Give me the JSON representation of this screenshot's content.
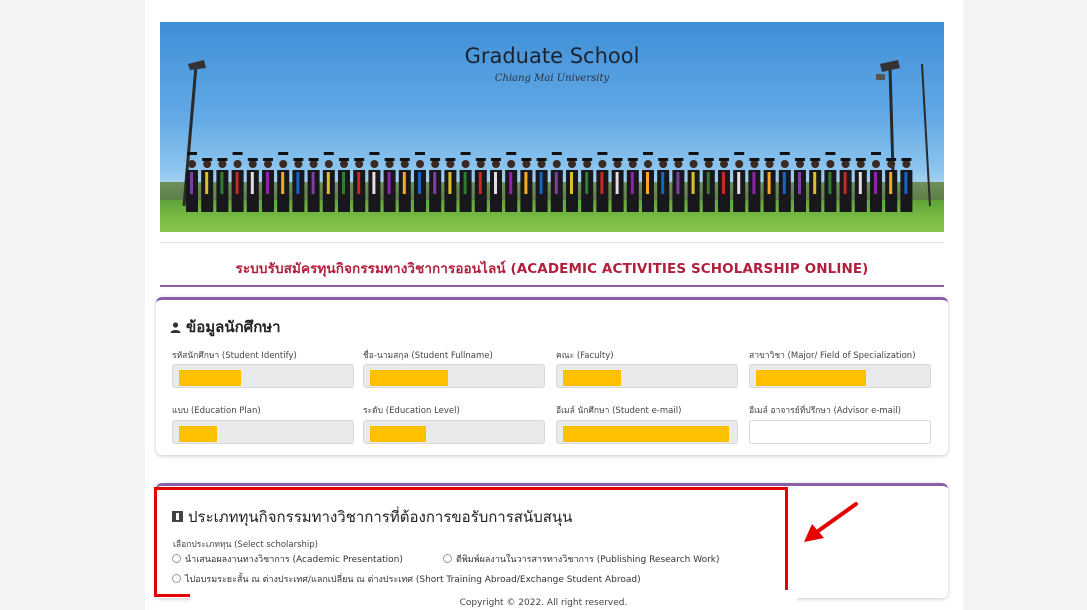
{
  "banner": {
    "title": "Graduate School",
    "subtitle": "Chiang Mai University"
  },
  "system_title": "ระบบรับสมัครทุนกิจกรรมทางวิชาการออนไลน์ (ACADEMIC ACTIVITIES SCHOLARSHIP ONLINE)",
  "student_section": {
    "title": "ข้อมูลนักศึกษา",
    "fields": [
      {
        "label": "รหัสนักศึกษา (Student Identify)",
        "redacted": true
      },
      {
        "label": "ชื่อ-นามสกุล (Student Fullname)",
        "redacted": true
      },
      {
        "label": "คณะ (Faculty)",
        "redacted": true
      },
      {
        "label": "สาขาวิชา (Major/ Field of Specialization)",
        "redacted": true
      },
      {
        "label": "แบบ (Education Plan)",
        "redacted": true
      },
      {
        "label": "ระดับ (Education Level)",
        "redacted": true
      },
      {
        "label": "อีเมล์ นักศึกษา (Student e-mail)",
        "redacted": true
      },
      {
        "label": "อีเมล์ อาจารย์ที่ปรึกษา (Advisor e-mail)",
        "redacted": false,
        "value": ""
      }
    ]
  },
  "scholarship_section": {
    "title": "ประเภททุนกิจกรรมทางวิชาการที่ต้องการขอรับการสนับสนุน",
    "select_label": "เลือกประเภททุน (Select scholarship)",
    "options": [
      "นำเสนอผลงานทางวิชาการ (Academic Presentation)",
      "ตีพิมพ์ผลงานในวารสารทางวิชาการ (Publishing Research Work)",
      "ไปอบรมระยะสั้น ณ ต่างประเทศ/แลกเปลี่ยน ณ ต่างประเทศ (Short Training Abroad/Exchange Student Abroad)"
    ]
  },
  "footer": "Copyright © 2022. All right reserved.",
  "colors": {
    "accent_purple": "#8a5fa8",
    "title_red": "#b11f3c",
    "redaction": "#ffc000",
    "highlight": "#e60000"
  },
  "icons": [
    "user-icon",
    "info-icon",
    "arrow-icon"
  ]
}
